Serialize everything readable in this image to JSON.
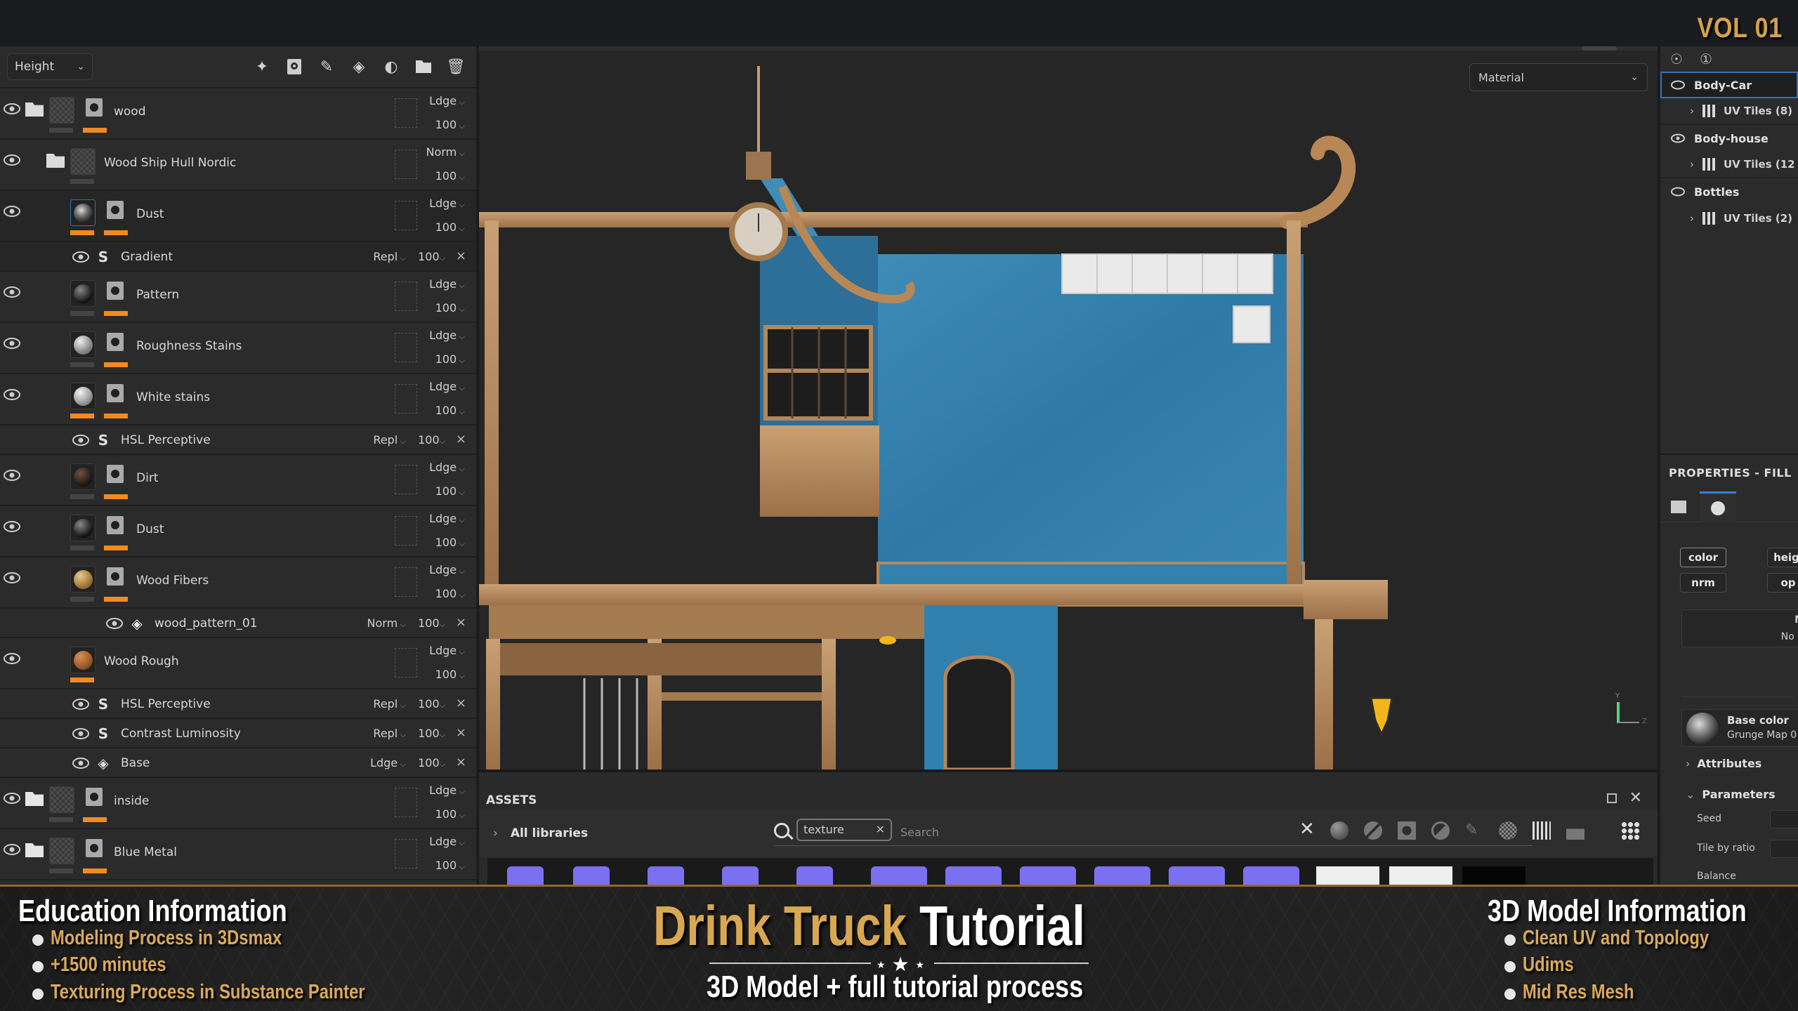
{
  "header": {
    "volume_badge": "VOL 01"
  },
  "layers_panel": {
    "channel_select": "Height",
    "toolbar_icons": [
      "magic-wand-icon",
      "smart-mask-icon",
      "paint-brush-icon",
      "fill-bucket-icon",
      "effects-icon",
      "folder-icon",
      "trash-icon"
    ],
    "rows": [
      {
        "type": "folder",
        "name": "wood",
        "blend": "Ldge",
        "opacity": "100",
        "indent": 0,
        "bars": [
          "off",
          "on"
        ]
      },
      {
        "type": "folder",
        "name": "Wood Ship Hull Nordic",
        "blend": "Norm",
        "opacity": "100",
        "indent": 1,
        "bars": [
          "off"
        ]
      },
      {
        "type": "fill",
        "name": "Dust",
        "blend": "Ldge",
        "opacity": "100",
        "selected": true,
        "bars": [
          "on",
          "on"
        ]
      },
      {
        "type": "effect",
        "name": "Gradient",
        "blend": "Repl",
        "opacity": "100"
      },
      {
        "type": "fill",
        "name": "Pattern",
        "blend": "Ldge",
        "opacity": "100",
        "bars": [
          "off",
          "on"
        ]
      },
      {
        "type": "fill",
        "name": "Roughness Stains",
        "blend": "Ldge",
        "opacity": "100",
        "bars": [
          "off",
          "on"
        ]
      },
      {
        "type": "fill",
        "name": "White stains",
        "blend": "Ldge",
        "opacity": "100",
        "bars": [
          "on",
          "on"
        ]
      },
      {
        "type": "effect",
        "name": "HSL Perceptive",
        "blend": "Repl",
        "opacity": "100"
      },
      {
        "type": "fill",
        "name": "Dirt",
        "blend": "Ldge",
        "opacity": "100",
        "bars": [
          "off",
          "on"
        ]
      },
      {
        "type": "fill",
        "name": "Dust",
        "blend": "Ldge",
        "opacity": "100",
        "bars": [
          "off",
          "on"
        ]
      },
      {
        "type": "fill",
        "name": "Wood Fibers",
        "blend": "Ldge",
        "opacity": "100",
        "bars": [
          "off",
          "on"
        ]
      },
      {
        "type": "effect",
        "name": "wood_pattern_01",
        "blend": "Norm",
        "opacity": "100"
      },
      {
        "type": "fill",
        "name": "Wood Rough",
        "blend": "Ldge",
        "opacity": "100",
        "bars": [
          "on"
        ]
      },
      {
        "type": "effect",
        "name": "HSL Perceptive",
        "blend": "Repl",
        "opacity": "100"
      },
      {
        "type": "effect",
        "name": "Contrast Luminosity",
        "blend": "Repl",
        "opacity": "100"
      },
      {
        "type": "effect",
        "name": "Base",
        "blend": "Ldge",
        "opacity": "100"
      },
      {
        "type": "folder",
        "name": "inside",
        "blend": "Ldge",
        "opacity": "100",
        "bars": [
          "off",
          "on"
        ]
      },
      {
        "type": "folder",
        "name": "Blue Metal",
        "blend": "Ldge",
        "opacity": "100",
        "bars": [
          "off",
          "on"
        ]
      }
    ]
  },
  "viewport": {
    "display_mode": "Material",
    "gizmo": {
      "y_label": "Y",
      "z_label": "Z"
    },
    "accent_colors": {
      "wood": "#b98a5a",
      "blue_paint": "#3d86b3",
      "lamp": "#f2b51c"
    }
  },
  "texture_sets": {
    "items": [
      {
        "name": "Body-Car",
        "uv_tiles": "UV Tiles (8)",
        "selected": true
      },
      {
        "name": "Body-house",
        "uv_tiles": "UV Tiles (12"
      },
      {
        "name": "Bottles",
        "uv_tiles": "UV Tiles (2)"
      }
    ]
  },
  "properties": {
    "title": "PROPERTIES - FILL",
    "channels": [
      "color",
      "heigl",
      "nrm",
      "op"
    ],
    "material_box": {
      "line1": "M",
      "line2": "No R"
    },
    "base_color": {
      "label": "Base color",
      "source": "Grunge Map 0"
    },
    "attributes_label": "Attributes",
    "parameters_label": "Parameters",
    "params": [
      "Seed",
      "Tile by ratio",
      "Balance"
    ]
  },
  "assets": {
    "title": "ASSETS",
    "library": "All libraries",
    "search_chip": "texture",
    "search_placeholder": "Search"
  },
  "banner": {
    "left_title": "Education Information",
    "left_items": [
      "Modeling Process in 3Dsmax",
      "+1500 minutes",
      "Texturing Process in Substance Painter"
    ],
    "center_title_gold": "Drink Truck",
    "center_title_white": "Tutorial",
    "center_subtitle": "3D Model + full tutorial process",
    "right_title": "3D Model Information",
    "right_items": [
      "Clean UV and Topology",
      "Udims",
      "Mid Res Mesh"
    ],
    "colors": {
      "gold": "#d8a752",
      "white": "#ffffff"
    }
  }
}
